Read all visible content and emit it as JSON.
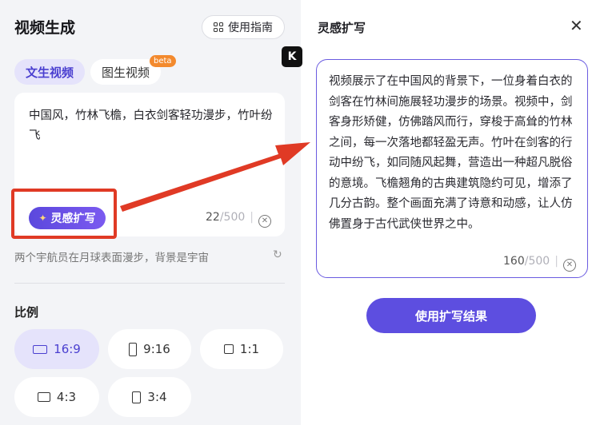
{
  "left_panel": {
    "title": "视频生成",
    "guide_button": "使用指南",
    "tabs": [
      {
        "label": "文生视频",
        "active": true
      },
      {
        "label": "图生视频",
        "badge": "beta"
      }
    ],
    "prompt": {
      "text": "中国风，竹林飞檐，白衣剑客轻功漫步，竹叶纷飞",
      "expand_button": "灵感扩写",
      "count": "22",
      "max": "/500"
    },
    "suggestion": "两个宇航员在月球表面漫步，背景是宇宙",
    "ratio_section": {
      "label": "比例",
      "options": [
        {
          "label": "16:9",
          "selected": true
        },
        {
          "label": "9:16"
        },
        {
          "label": "1:1"
        },
        {
          "label": "4:3"
        },
        {
          "label": "3:4"
        }
      ]
    }
  },
  "logo": {
    "text": "K"
  },
  "right_panel": {
    "title": "灵感扩写",
    "result_text": "视频展示了在中国风的背景下，一位身着白衣的剑客在竹林间施展轻功漫步的场景。视频中，剑客身形矫健，仿佛踏风而行，穿梭于高耸的竹林之间，每一次落地都轻盈无声。竹叶在剑客的行动中纷飞，如同随风起舞，营造出一种超凡脱俗的意境。飞檐翘角的古典建筑隐约可见，增添了几分古韵。整个画面充满了诗意和动感，让人仿佛置身于古代武侠世界之中。",
    "count": "160",
    "max": "/500",
    "apply_button": "使用扩写结果"
  },
  "colors": {
    "accent": "#5d4ee0",
    "highlight_red": "#e03a25",
    "beta_badge": "#f38a2e"
  }
}
